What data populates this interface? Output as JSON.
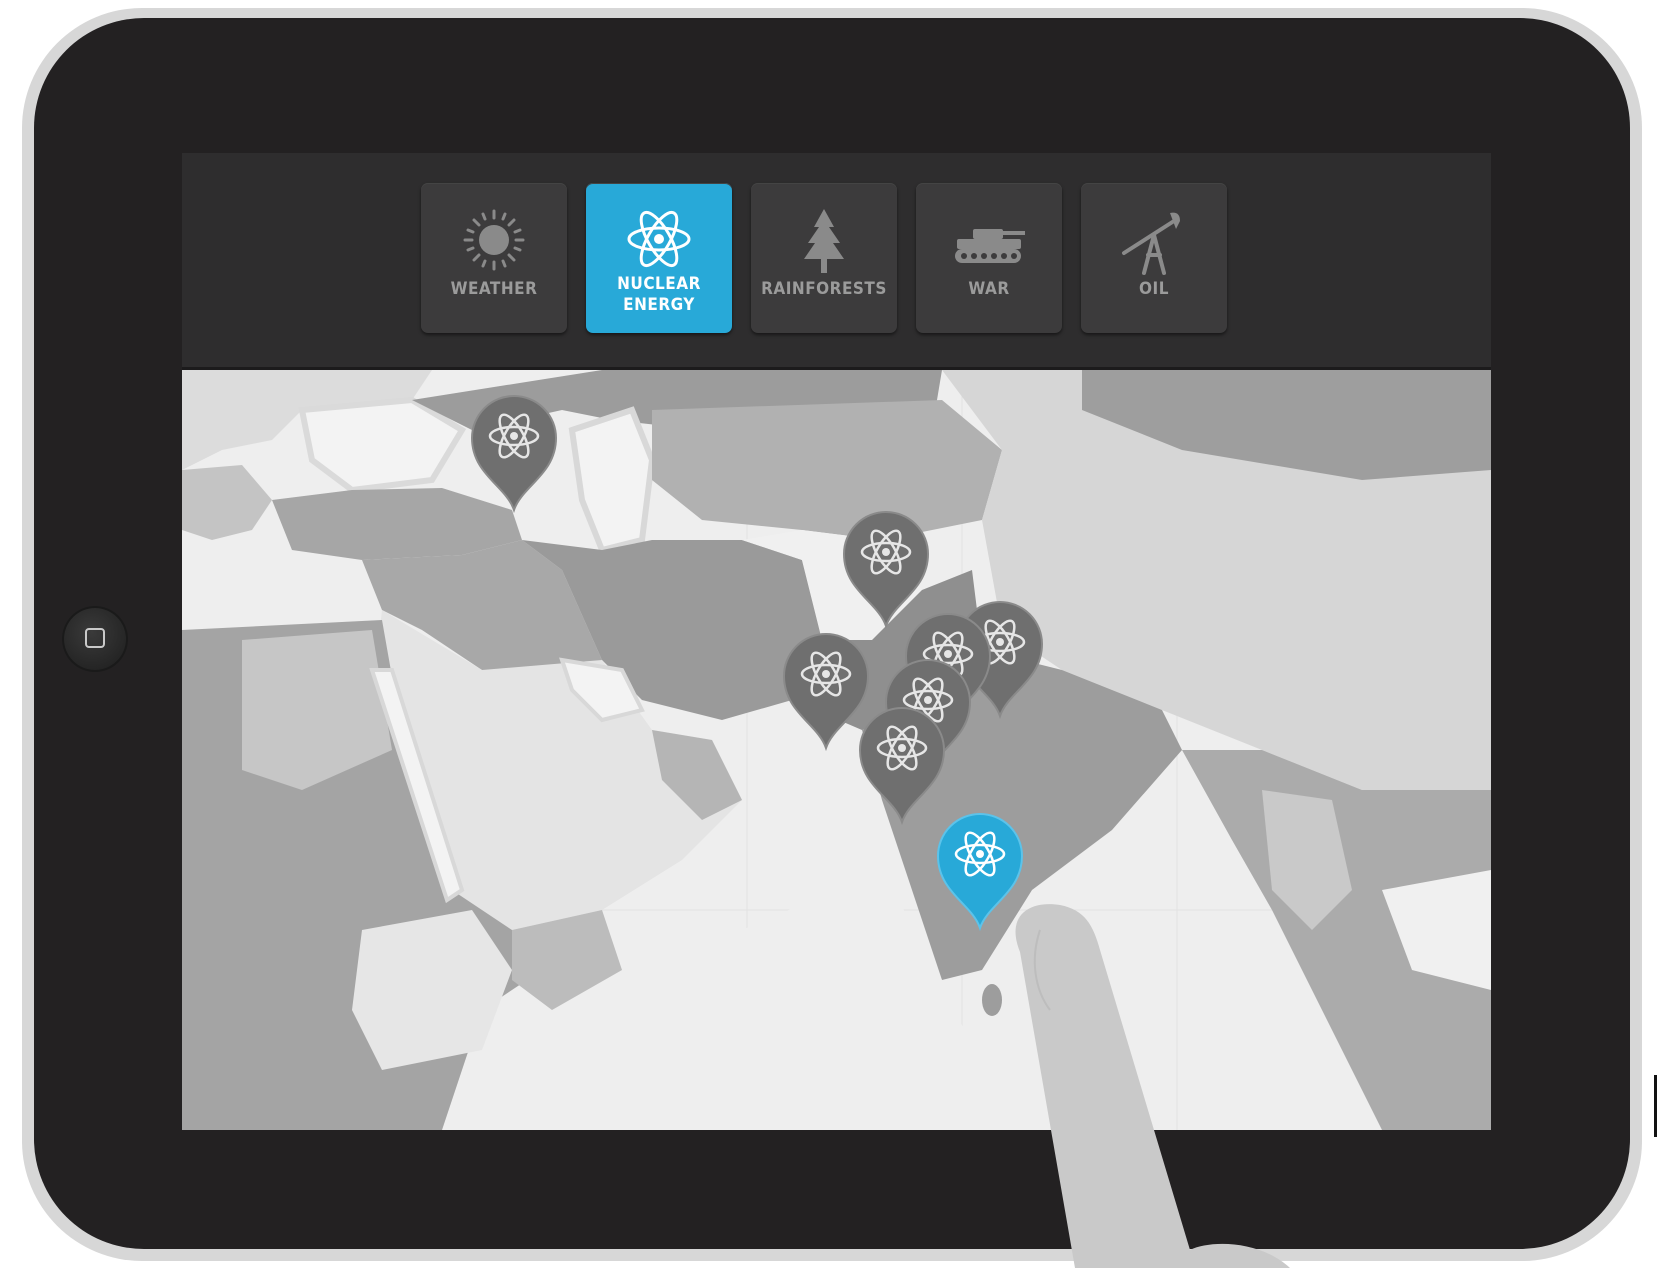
{
  "toolbar": {
    "categories": [
      {
        "id": "weather",
        "label": "WEATHER",
        "label2": "",
        "icon": "sun-icon",
        "active": false
      },
      {
        "id": "nuclear",
        "label": "NUCLEAR",
        "label2": "ENERGY",
        "icon": "atom-icon",
        "active": true
      },
      {
        "id": "rainforests",
        "label": "RAINFORESTS",
        "label2": "",
        "icon": "tree-icon",
        "active": false
      },
      {
        "id": "war",
        "label": "WAR",
        "label2": "",
        "icon": "tank-icon",
        "active": false
      },
      {
        "id": "oil",
        "label": "OIL",
        "label2": "",
        "icon": "oil-pump-icon",
        "active": false
      }
    ]
  },
  "map": {
    "pin_icon": "atom-icon",
    "pin_count": 8,
    "selected_pin_color": "#28a9d8",
    "pin_color": "#6f6f6f"
  },
  "colors": {
    "accent": "#28a9d8",
    "bezel": "#232122",
    "toolbar": "#2e2d2e"
  }
}
